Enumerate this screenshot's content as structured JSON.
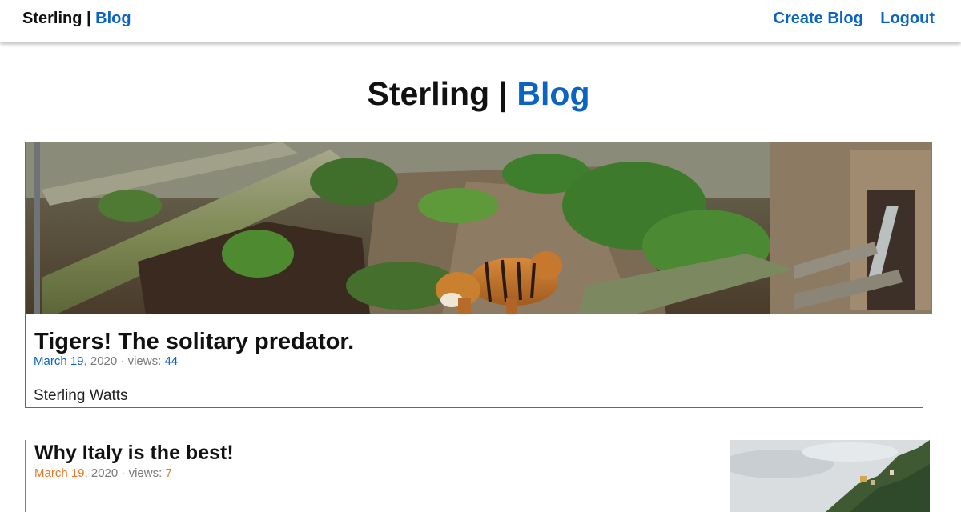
{
  "nav": {
    "brand_name": "Sterling",
    "brand_sep": " | ",
    "brand_accent": "Blog",
    "links": [
      "Create Blog",
      "Logout"
    ]
  },
  "header": {
    "title_name": "Sterling",
    "title_sep": " | ",
    "title_accent": "Blog"
  },
  "posts": [
    {
      "title": "Tigers! The solitary predator.",
      "date_month_day": "March 19",
      "date_year": ", 2020",
      "views_label": " · views: ",
      "views": "44",
      "author": "Sterling Watts",
      "image": "tiger-enclosure-photo",
      "accent_color": "#0a64c2"
    },
    {
      "title": "Why Italy is the best!",
      "date_month_day": "March 19",
      "date_year": ", 2020",
      "views_label": " · views: ",
      "views": "7",
      "image": "italy-coast-photo",
      "accent_color": "#e8782a"
    }
  ],
  "colors": {
    "accent_blue": "#0a64c2",
    "accent_orange": "#e8782a",
    "card_border_gold": "#8a6418",
    "card_border_blue": "#4a8fcf"
  }
}
